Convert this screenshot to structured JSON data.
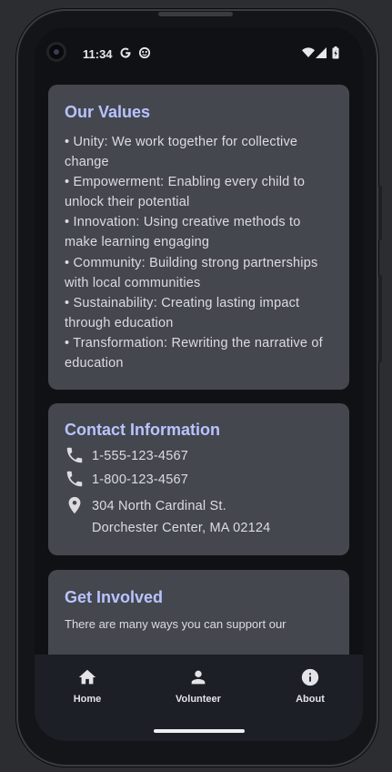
{
  "status_bar": {
    "time": "11:34",
    "left_icons": [
      "google-icon",
      "notification-icon"
    ],
    "right_icons": [
      "wifi-icon",
      "signal-icon",
      "battery-icon"
    ]
  },
  "values_card": {
    "title": "Our Values",
    "items": [
      "• Unity: We work together for collective change",
      "• Empowerment: Enabling every child to unlock their potential",
      "• Innovation: Using creative methods to make learning engaging",
      "• Community: Building strong partnerships with local communities",
      "• Sustainability: Creating lasting impact through education",
      "• Transformation: Rewriting the narrative of education"
    ]
  },
  "contact_card": {
    "title": "Contact Information",
    "phone1": "1-555-123-4567",
    "phone2": "1-800-123-4567",
    "address_line1": "304 North Cardinal St.",
    "address_line2": "Dorchester Center, MA 02124",
    "icons": [
      "phone-icon",
      "phone-icon",
      "location-pin-icon"
    ]
  },
  "involved_card": {
    "title": "Get Involved",
    "text": "There are many ways you can support our"
  },
  "bottom_nav": [
    {
      "label": "Home",
      "icon": "home-icon"
    },
    {
      "label": "Volunteer",
      "icon": "person-icon"
    },
    {
      "label": "About",
      "icon": "info-icon"
    }
  ],
  "colors": {
    "accent": "#b8c4ff",
    "card": "#45474f",
    "background": "#101114",
    "nav": "#1d1f26"
  }
}
